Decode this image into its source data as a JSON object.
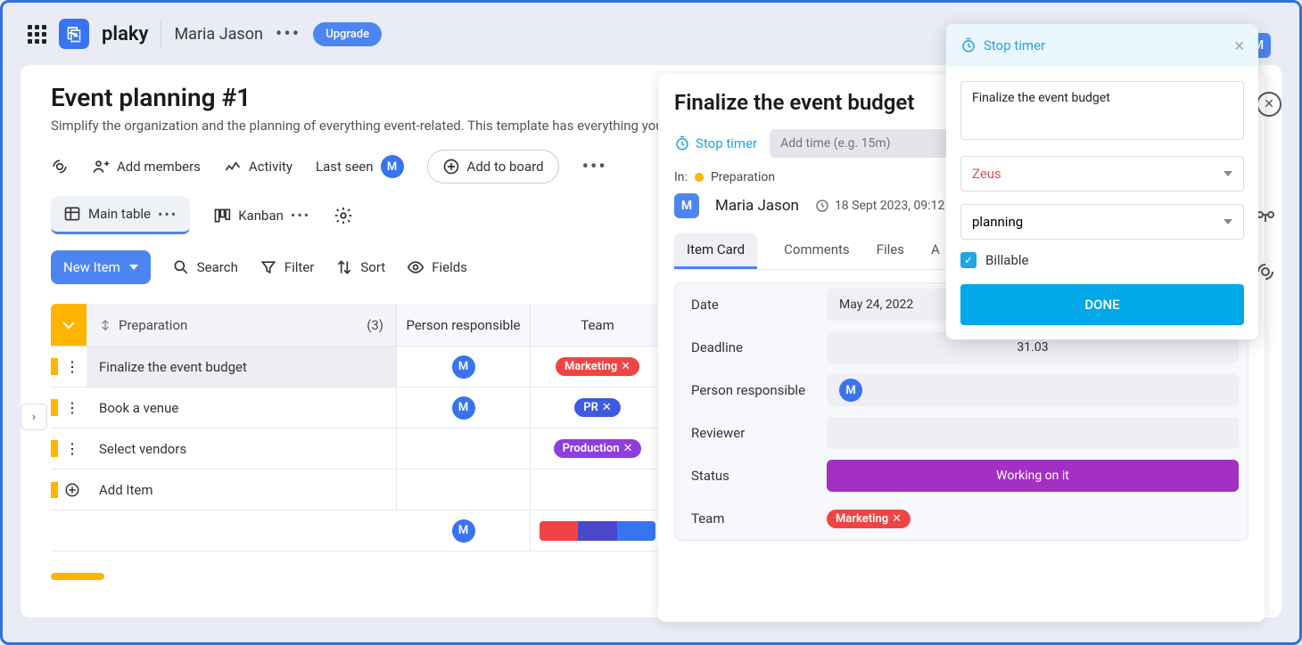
{
  "brand": "plaky",
  "user": "Maria Jason",
  "user_initial": "M",
  "upgrade_label": "Upgrade",
  "board": {
    "title": "Event planning #1",
    "subtitle": "Simplify the organization and the planning of everything event-related. This template has everything you need"
  },
  "toolbar": {
    "add_members": "Add members",
    "activity": "Activity",
    "last_seen": "Last seen",
    "add_to_board": "Add to board",
    "main_table": "Main table",
    "kanban": "Kanban",
    "new_item": "New Item",
    "search": "Search",
    "filter": "Filter",
    "sort": "Sort",
    "fields": "Fields"
  },
  "table": {
    "group_name": "Preparation",
    "group_count": "(3)",
    "col_person": "Person responsible",
    "col_team": "Team",
    "rows": [
      {
        "name": "Finalize the event budget",
        "person": "M",
        "team": "Marketing",
        "team_color": "tag-red"
      },
      {
        "name": "Book a venue",
        "person": "M",
        "team": "PR",
        "team_color": "tag-blue"
      },
      {
        "name": "Select vendors",
        "person": "",
        "team": "Production",
        "team_color": "tag-purple"
      }
    ],
    "add_item": "Add Item",
    "footer_person": "M"
  },
  "card": {
    "title": "Finalize the event budget",
    "stop_timer": "Stop timer",
    "add_time_placeholder": "Add time (e.g. 15m)",
    "in_label": "In:",
    "group": "Preparation",
    "author": "Maria Jason",
    "author_initial": "M",
    "timestamp": "18 Sept 2023, 09:12",
    "tabs": {
      "item_card": "Item  Card",
      "comments": "Comments",
      "files": "Files",
      "activity": "A"
    },
    "fields": {
      "date_label": "Date",
      "date_value": "May 24, 2022",
      "deadline_label": "Deadline",
      "deadline_value": "31.03",
      "person_label": "Person responsible",
      "person_value": "M",
      "reviewer_label": "Reviewer",
      "status_label": "Status",
      "status_value": "Working on it",
      "team_label": "Team",
      "team_value": "Marketing"
    }
  },
  "timer": {
    "header": "Stop timer",
    "description": "Finalize the event budget",
    "project": "Zeus",
    "tag": "planning",
    "billable": "Billable",
    "done": "DONE"
  }
}
